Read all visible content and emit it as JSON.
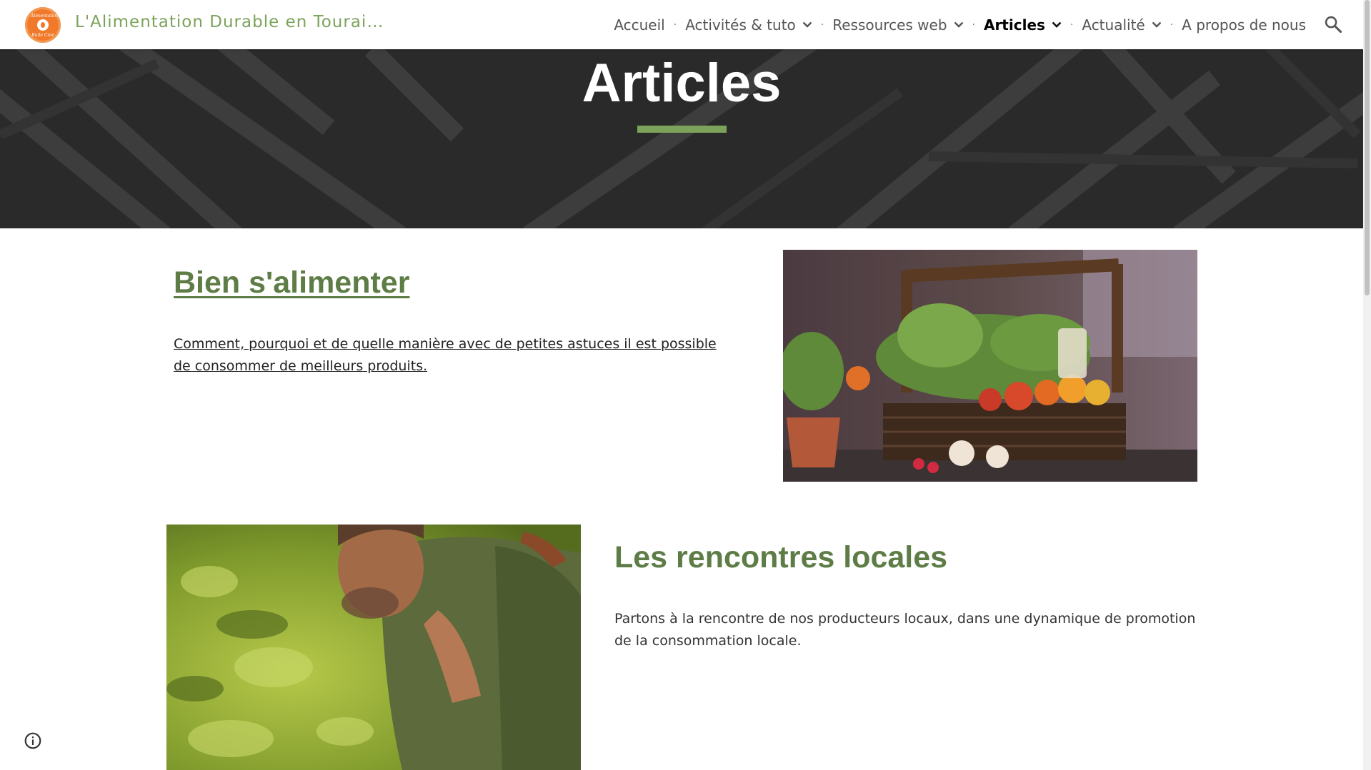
{
  "header": {
    "site_title": "L'Alimentation Durable en Tourai…",
    "logo_line1": "Alimentation",
    "logo_line2": "Bulle Ciné",
    "nav": [
      {
        "label": "Accueil"
      },
      {
        "label": "Activités & tuto"
      },
      {
        "label": "Ressources web"
      },
      {
        "label": "Articles"
      },
      {
        "label": "Actualité"
      },
      {
        "label": "A propos de nous"
      }
    ],
    "separator": "·"
  },
  "banner": {
    "title": "Articles"
  },
  "sections": [
    {
      "title": "Bien s'alimenter",
      "text": "Comment, pourquoi et de quelle manière avec de petites astuces il est possible de consommer de meilleurs produits."
    },
    {
      "title": "Les rencontres locales",
      "text": "Partons à la rencontre de nos producteurs locaux, dans une dynamique de promotion de la consommation locale."
    }
  ],
  "colors": {
    "accent": "#7ca35b",
    "title_green": "#5e7d46",
    "logo_orange": "#f07a2a",
    "banner_bg": "#2b2b2b"
  },
  "icons": [
    "search-icon",
    "chevron-down-icon",
    "info-icon"
  ]
}
